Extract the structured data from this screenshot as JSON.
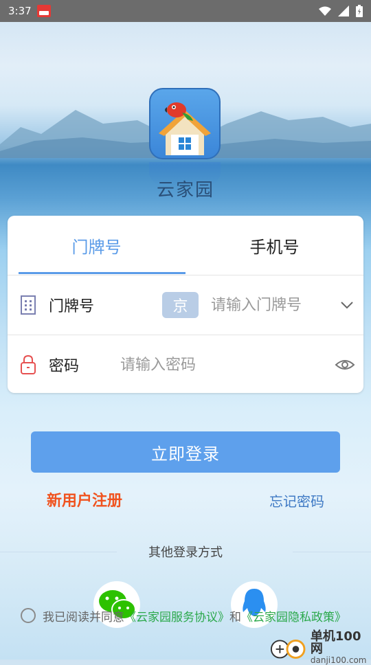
{
  "status_bar": {
    "time": "3:37"
  },
  "app": {
    "name": "云家园"
  },
  "tabs": [
    {
      "label": "门牌号",
      "active": true
    },
    {
      "label": "手机号",
      "active": false
    }
  ],
  "form": {
    "door_label": "门牌号",
    "door_prefix": "京",
    "door_placeholder": "请输入门牌号",
    "password_label": "密码",
    "password_placeholder": "请输入密码"
  },
  "actions": {
    "login_label": "立即登录",
    "register_label": "新用户注册",
    "forgot_label": "忘记密码"
  },
  "other_login": {
    "title": "其他登录方式"
  },
  "agreement": {
    "prefix": "我已阅读并同意",
    "service_link": "《云家园服务协议》",
    "connector": "和",
    "privacy_link": "《云家园隐私政策》"
  },
  "watermark": {
    "title": "单机100网",
    "url": "danji100.com"
  },
  "colors": {
    "accent": "#5a9be8",
    "register": "#f0531f",
    "link": "#2aa84a"
  },
  "icons": [
    "building-icon",
    "lock-icon",
    "chevron-down-icon",
    "eye-icon",
    "wechat-icon",
    "qq-icon"
  ]
}
